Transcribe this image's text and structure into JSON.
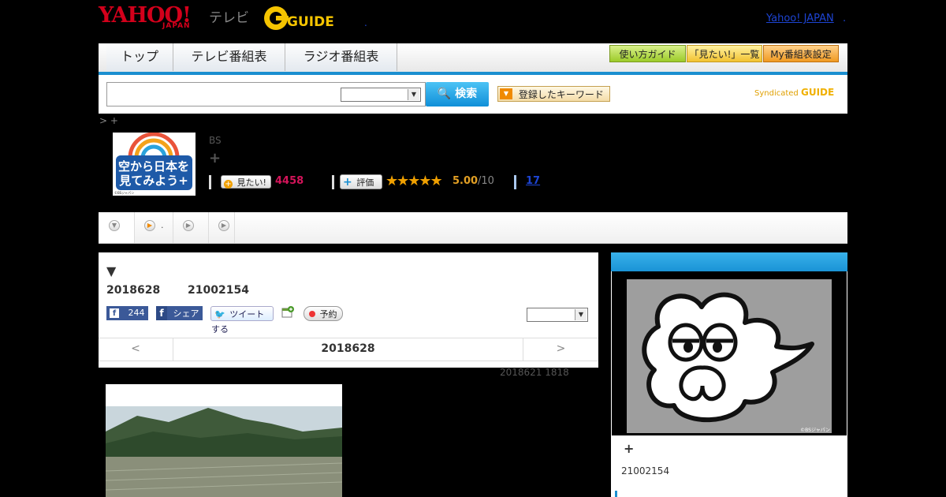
{
  "header": {
    "brand_yahoo": "YAHOO!",
    "brand_japan": "JAPAN",
    "brand_tv": "テレビ",
    "brand_gguide": "GUIDE",
    "yahoo_japan_link": "Yahoo! JAPAN",
    "link_sep": ".",
    "dot": "."
  },
  "nav": {
    "tabs": [
      {
        "label": "トップ"
      },
      {
        "label": "テレビ番組表"
      },
      {
        "label": "ラジオ番組表"
      }
    ],
    "guide_buttons": [
      {
        "label": "使い方ガイド"
      },
      {
        "label": "「見たい!」一覧"
      },
      {
        "label": "My番組表設定"
      }
    ]
  },
  "search": {
    "input_value": "",
    "select_value": "",
    "button_label": "検索",
    "keyword_button": "登録したキーワード",
    "syndicated": "Syndicated"
  },
  "program": {
    "breadcrumb": "> +",
    "thumb_text": "空から日本を見てみよう+",
    "thumb_credit": "©BSジャパン",
    "channel": "BS",
    "title": "+",
    "mitai_label": "見たい!",
    "mitai_count": "4458",
    "hyoka_label": "評価",
    "stars": "★★★★★",
    "rating": "5.00",
    "rating_max": "/10",
    "review_count": "17"
  },
  "tabs_row": {
    "tab2_text": "."
  },
  "detail": {
    "arrow": "▼",
    "date": "2018628",
    "time": "21002154",
    "fb_count": "244",
    "fb_share": "シェア",
    "tweet": "ツイートする",
    "yoyaku": "予約",
    "select_value": "",
    "prev": "<",
    "next": ">",
    "nav_date": "2018628",
    "updated": "2018621  1818"
  },
  "sidebar": {
    "image_credit": "©BSジャパン",
    "plus": "+",
    "time": "21002154"
  },
  "colors": {
    "accent_blue": "#1b8fd0",
    "mitai_pink": "#d4145a",
    "rating_gold": "#e3a024",
    "facebook": "#3b5998",
    "link_blue": "#1d44d3"
  }
}
